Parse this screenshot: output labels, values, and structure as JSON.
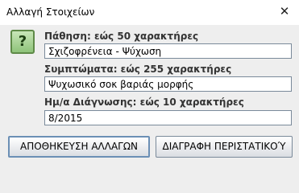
{
  "window": {
    "title": "Αλλαγή Στοιχείων",
    "close_glyph": "✕"
  },
  "icon": {
    "name": "question-icon",
    "glyph": "?"
  },
  "form": {
    "disease_label": "Πάθηση: εώς 50 χαρακτήρες",
    "disease_value": "Σχιζοφρένεια - Ψύχωση",
    "symptoms_label": "Συμπτώματα: εώς 255 χαρακτήρες",
    "symptoms_value": "Ψυχωσικό σοκ βαριάς μορφής",
    "diagnosis_date_label": "Ημ/α Διάγνωσης: εώς 10 χαρακτήρες",
    "diagnosis_date_value": "8/2015"
  },
  "buttons": {
    "save_label": "ΑΠΟΘΗΚΕΥΣΗ ΑΛΛΑΓΩΝ",
    "delete_label": "ΔΙΑΓΡΑΦΗ ΠΕΡΙΣΤΑΤΙΚΟΎ"
  }
}
